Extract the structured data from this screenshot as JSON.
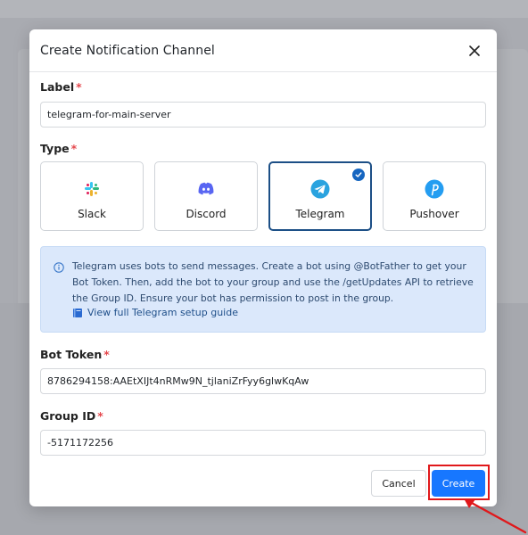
{
  "dialog": {
    "title": "Create Notification Channel",
    "close_icon": "close-icon"
  },
  "label_field": {
    "label": "Label",
    "required_mark": "*",
    "value": "telegram-for-main-server"
  },
  "type_field": {
    "label": "Type",
    "required_mark": "*",
    "options": [
      {
        "name": "Slack",
        "icon": "slack-icon",
        "selected": false
      },
      {
        "name": "Discord",
        "icon": "discord-icon",
        "selected": false
      },
      {
        "name": "Telegram",
        "icon": "telegram-icon",
        "selected": true
      },
      {
        "name": "Pushover",
        "icon": "pushover-icon",
        "selected": false
      }
    ]
  },
  "info": {
    "icon": "info-icon",
    "text": "Telegram uses bots to send messages. Create a bot using @BotFather to get your Bot Token. Then, add the bot to your group and use the /getUpdates API to retrieve the Group ID. Ensure your bot has permission to post in the group.",
    "link_icon": "book-icon",
    "link_text": "View full Telegram setup guide"
  },
  "bot_token_field": {
    "label": "Bot Token",
    "required_mark": "*",
    "value": "8786294158:AAEtXIJt4nRMw9N_tjlaniZrFyy6glwKqAw"
  },
  "group_id_field": {
    "label": "Group ID",
    "required_mark": "*",
    "value": "-5171172256"
  },
  "actions": {
    "cancel_label": "Cancel",
    "create_label": "Create"
  },
  "colors": {
    "primary": "#1777ff",
    "selected_border": "#1c4f86",
    "info_bg": "#dbe8fb",
    "required": "#e5484d",
    "annotation": "#e0181b"
  }
}
